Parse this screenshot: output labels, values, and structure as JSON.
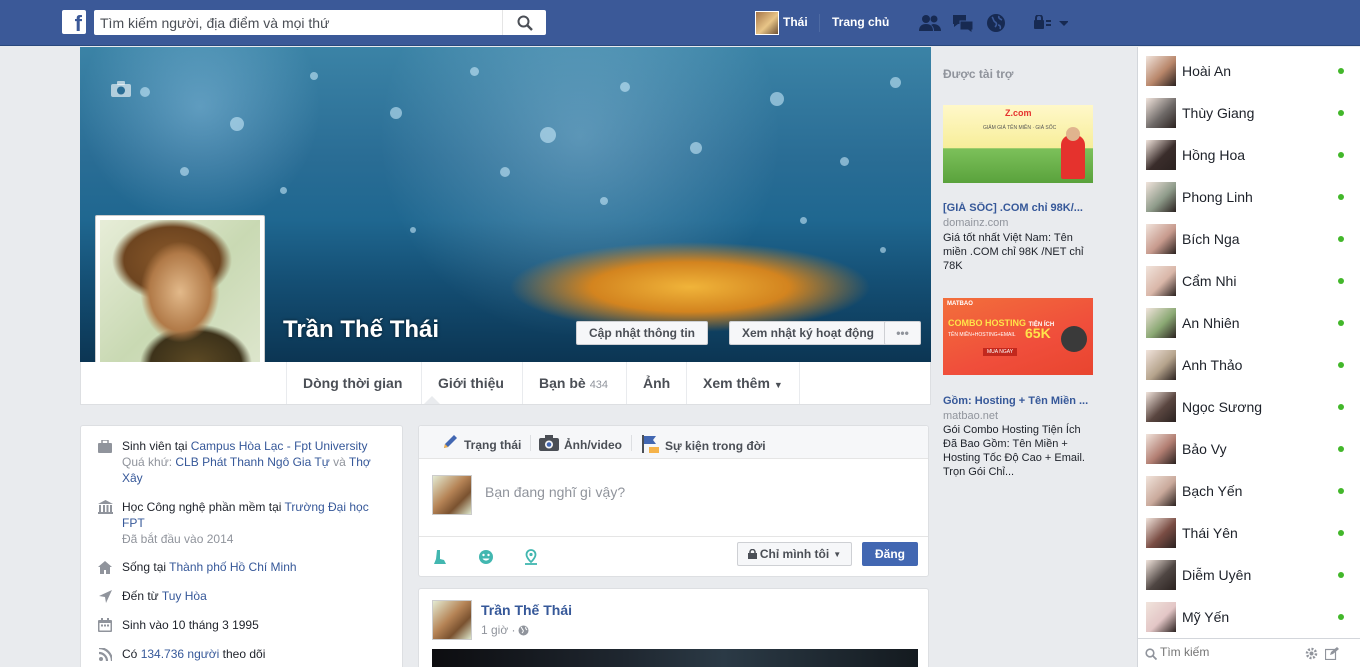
{
  "topbar": {
    "search_placeholder": "Tìm kiếm người, địa điểm và mọi thứ",
    "user_name": "Thái",
    "home_label": "Trang chủ"
  },
  "profile": {
    "name": "Trần Thế Thái",
    "update_info_label": "Cập nhật thông tin",
    "activity_log_label": "Xem nhật ký hoạt động",
    "more_label": "•••"
  },
  "tabs": [
    {
      "label": "Dòng thời gian"
    },
    {
      "label": "Giới thiệu"
    },
    {
      "label": "Bạn bè",
      "count": "434"
    },
    {
      "label": "Ảnh"
    },
    {
      "label": "Xem thêm"
    }
  ],
  "intro": {
    "work_prefix": "Sinh viên tại ",
    "work_link": "Campus Hòa Lạc - Fpt University",
    "past_prefix": "Quá khứ: ",
    "past_link_1": "CLB Phát Thanh Ngô Gia Tự",
    "past_and": " và ",
    "past_link_2": "Thợ Xây",
    "edu_prefix": "Học Công nghệ phần mềm tại ",
    "edu_link": "Trường Đại học FPT",
    "edu_since": "Đã bắt đầu vào 2014",
    "lives_prefix": "Sống tại ",
    "lives_link": "Thành phố Hồ Chí Minh",
    "from_prefix": "Đến từ ",
    "from_link": "Tuy Hòa",
    "born": "Sinh vào 10 tháng 3 1995",
    "followers_prefix": "Có ",
    "followers_link": "134.736 người",
    "followers_suffix": " theo dõi"
  },
  "composer": {
    "tab_status": "Trạng thái",
    "tab_photo": "Ảnh/video",
    "tab_event": "Sự kiện trong đời",
    "placeholder": "Bạn đang nghĩ gì vậy?",
    "privacy_label": "Chỉ mình tôi",
    "post_label": "Đăng"
  },
  "post": {
    "author": "Trần Thế Thái",
    "time": "1 giờ · "
  },
  "sponsored": {
    "title": "Được tài trợ",
    "ads": [
      {
        "title": "[GIÁ SỐC] .COM chỉ 98K/...",
        "domain": "domainz.com",
        "desc": "Giá tốt nhất Việt Nam: Tên miền .COM chỉ 98K /NET chỉ 78K",
        "banner_brand": "Z.com",
        "banner_text": "GIẢM GIÁ TÊN MIỀN · GIÁ SỐC"
      },
      {
        "title": "Gồm: Hosting + Tên Miền ...",
        "domain": "matbao.net",
        "desc": "Gói Combo Hosting Tiện Ích Đã Bao Gồm: Tên Miền + Hosting Tốc Độ Cao + Email. Trọn Gói Chỉ...",
        "banner_brand": "MATBAO",
        "banner_text": "COMBO HOSTING",
        "banner_sub": "TIỆN ÍCH",
        "banner_line": "TÊN MIỀN+HOSTING+EMAIL",
        "banner_price": "65K",
        "banner_cta": "MUA NGAY"
      }
    ]
  },
  "chat": {
    "contacts": [
      {
        "name": "Hoài An",
        "color": "#b8866a"
      },
      {
        "name": "Thùy Giang",
        "color": "#6f6a68"
      },
      {
        "name": "Hồng Hoa",
        "color": "#3a2d2b"
      },
      {
        "name": "Phong Linh",
        "color": "#8e9b8a"
      },
      {
        "name": "Bích Nga",
        "color": "#c79a8d"
      },
      {
        "name": "Cẩm Nhi",
        "color": "#d9b6a8"
      },
      {
        "name": "An Nhiên",
        "color": "#8aa873"
      },
      {
        "name": "Anh Thảo",
        "color": "#b5a38c"
      },
      {
        "name": "Ngọc Sương",
        "color": "#5a4640"
      },
      {
        "name": "Bảo Vy",
        "color": "#b27e72"
      },
      {
        "name": "Bạch Yến",
        "color": "#c9a99b"
      },
      {
        "name": "Thái Yên",
        "color": "#7a4d44"
      },
      {
        "name": "Diễm Uyên",
        "color": "#4f4643"
      },
      {
        "name": "Mỹ Yến",
        "color": "#e3c6c6"
      }
    ],
    "search_placeholder": "Tìm kiếm"
  },
  "colors": {
    "brand": "#3b5998",
    "online": "#42b72a",
    "link": "#365899"
  }
}
